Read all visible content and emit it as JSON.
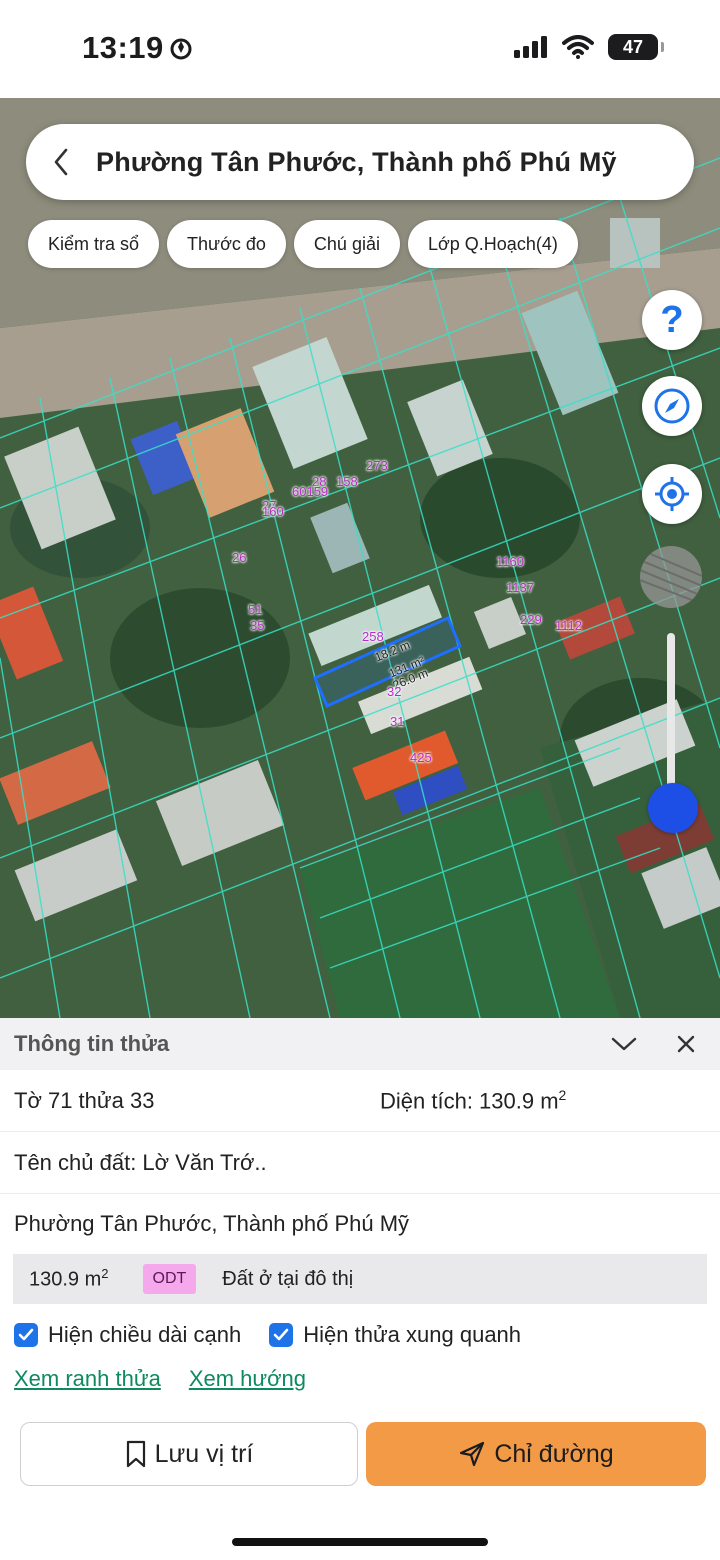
{
  "status_bar": {
    "time": "13:19",
    "battery": "47"
  },
  "search": {
    "title": "Phường Tân Phước, Thành phố Phú Mỹ"
  },
  "chips": [
    "Kiểm tra sổ",
    "Thước đo",
    "Chú giải",
    "Lớp Q.Hoạch(4)"
  ],
  "map_labels": [
    "273",
    "28",
    "60159",
    "158",
    "27",
    "160",
    "26",
    "51",
    "35",
    "258",
    "18.2 m",
    "131 m²",
    "26.0 m",
    "32",
    "31",
    "425",
    "1160",
    "1137",
    "229",
    "1112"
  ],
  "buttons_map": {
    "help": "?"
  },
  "panel": {
    "title": "Thông tin thửa",
    "sheet": "Tờ 71 thửa 33",
    "area_label": "Diện tích: 130.9 m",
    "area_sup": "2",
    "owner": "Tên chủ đất: Lờ Văn Trớ..",
    "address": "Phường Tân Phước, Thành phố Phú Mỹ",
    "land_area": "130.9 m",
    "land_area_sup": "2",
    "land_code": "ODT",
    "land_usage": "Đất ở tại đô thị",
    "check_edges": "Hiện chiều dài cạnh",
    "check_neighbors": "Hiện thửa xung quanh",
    "link_boundary": "Xem ranh thửa",
    "link_direction": "Xem hướng",
    "save_label": "Lưu vị trí",
    "directions_label": "Chỉ đường"
  },
  "colors": {
    "accent_orange": "#f29a45",
    "link_green": "#0d8a5e",
    "check_blue": "#1f73e8",
    "zoom_blue": "#1d4fe6",
    "parcel_highlight": "#1e6fff"
  }
}
